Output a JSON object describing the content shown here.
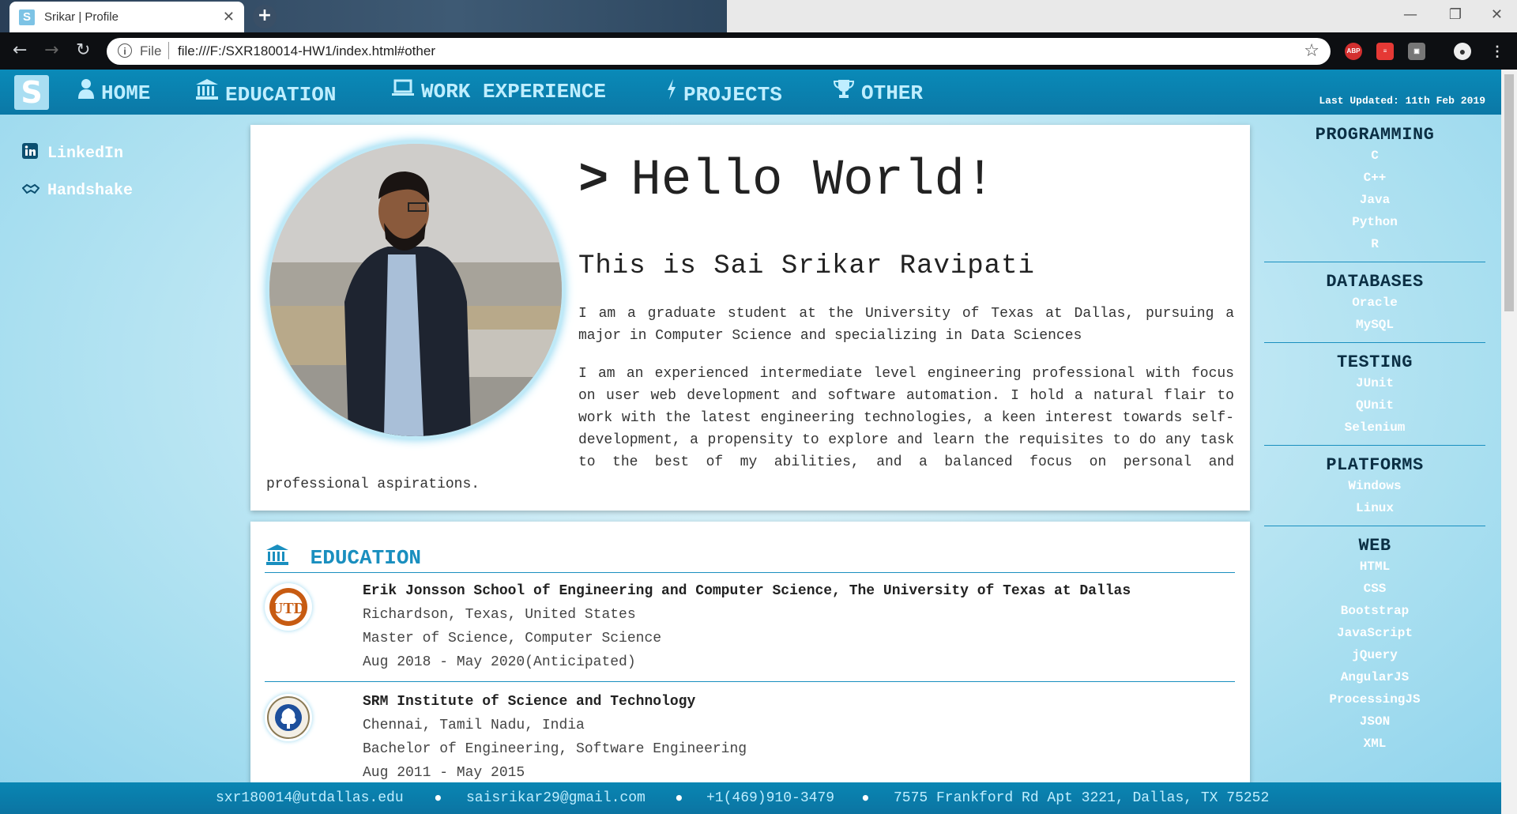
{
  "browser": {
    "tab_title": "Srikar | Profile",
    "tab_favicon": "S",
    "new_tab": "+",
    "omnibox_scheme": "File",
    "url": "file:///F:/SXR180014-HW1/index.html#other"
  },
  "site": {
    "logo": "S",
    "nav": [
      {
        "label": "HOME",
        "icon": "user-icon"
      },
      {
        "label": "EDUCATION",
        "icon": "university-icon"
      },
      {
        "label": "WORK EXPERIENCE",
        "icon": "laptop-icon"
      },
      {
        "label": "PROJECTS",
        "icon": "bolt-icon"
      },
      {
        "label": "OTHER",
        "icon": "trophy-icon"
      }
    ],
    "last_updated": "Last Updated: 11th Feb 2019"
  },
  "sidebar": {
    "links": [
      {
        "label": "LinkedIn",
        "icon": "linkedin-icon"
      },
      {
        "label": "Handshake",
        "icon": "handshake-icon"
      }
    ]
  },
  "hero": {
    "chevron": ">",
    "greeting": "Hello World!",
    "intro": "This is Sai Srikar Ravipati",
    "bio_1": "I am a graduate student at the University of Texas at Dallas, pursuing a major in Computer Science and specializing in Data Sciences",
    "bio_2": "I am an experienced intermediate level engineering professional with focus on user web development and software automation. I hold a natural flair to work with the latest engineering technologies, a keen interest towards self-development, a propensity to explore and learn the requisites to do any task to the best of my abilities, and a balanced focus on personal and professional aspirations."
  },
  "education": {
    "title": "EDUCATION",
    "schools": [
      {
        "name": "Erik Jonsson School of Engineering and Computer Science, The University of Texas at Dallas",
        "location": "Richardson, Texas, United States",
        "degree": "Master of Science, Computer Science",
        "dates": "Aug 2018 - May 2020(Anticipated)"
      },
      {
        "name": "SRM Institute of Science and Technology",
        "location": "Chennai, Tamil Nadu, India",
        "degree": "Bachelor of Engineering, Software Engineering",
        "dates": "Aug 2011 - May 2015"
      }
    ]
  },
  "skills": [
    {
      "title": "PROGRAMMING",
      "items": [
        "C",
        "C++",
        "Java",
        "Python",
        "R"
      ]
    },
    {
      "title": "DATABASES",
      "items": [
        "Oracle",
        "MySQL"
      ]
    },
    {
      "title": "TESTING",
      "items": [
        "JUnit",
        "QUnit",
        "Selenium"
      ]
    },
    {
      "title": "PLATFORMS",
      "items": [
        "Windows",
        "Linux"
      ]
    },
    {
      "title": "WEB",
      "items": [
        "HTML",
        "CSS",
        "Bootstrap",
        "JavaScript",
        "jQuery",
        "AngularJS",
        "ProcessingJS",
        "JSON",
        "XML"
      ]
    }
  ],
  "footer": {
    "email_1": "sxr180014@utdallas.edu",
    "email_2": "saisrikar29@gmail.com",
    "phone": "+1(469)910-3479",
    "address": "7575 Frankford Rd Apt 3221, Dallas, TX 75252"
  }
}
